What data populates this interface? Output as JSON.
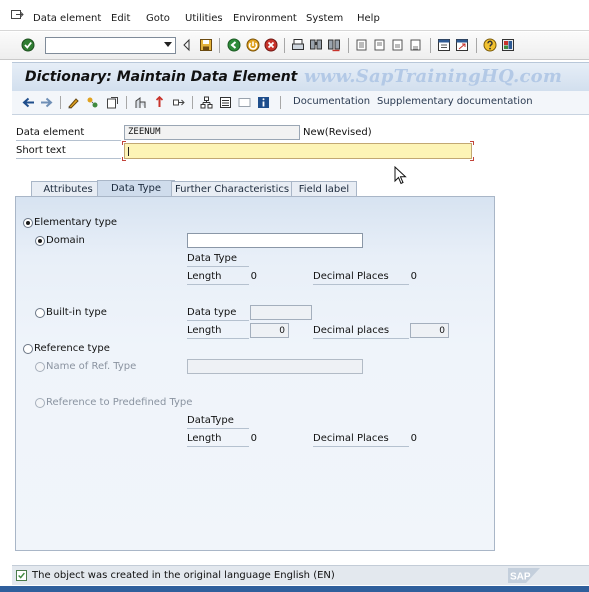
{
  "menu": {
    "items": [
      "Data element",
      "Edit",
      "Goto",
      "Utilities",
      "Environment",
      "System",
      "Help"
    ]
  },
  "toolbar": {
    "command_field_value": ""
  },
  "title": "Dictionary: Maintain Data Element",
  "watermark": "www.SapTrainingHQ.com",
  "app_toolbar": {
    "documentation_label": "Documentation",
    "supplementary_label": "Supplementary documentation"
  },
  "form": {
    "data_element_label": "Data element",
    "data_element_value": "ZEENUM",
    "status_text": "New(Revised)",
    "short_text_label": "Short text",
    "short_text_value": ""
  },
  "tabs": [
    {
      "label": "Attributes",
      "active": false
    },
    {
      "label": "Data Type",
      "active": true
    },
    {
      "label": "Further Characteristics",
      "active": false
    },
    {
      "label": "Field label",
      "active": false
    }
  ],
  "datatype_tab": {
    "elementary_type_label": "Elementary type",
    "domain_label": "Domain",
    "domain_value": "",
    "domain_data_type_label": "Data Type",
    "domain_length_label": "Length",
    "domain_length_value": "0",
    "domain_decimal_label": "Decimal Places",
    "domain_decimal_value": "0",
    "builtin_type_label": "Built-in type",
    "builtin_data_type_label": "Data type",
    "builtin_data_type_value": "",
    "builtin_length_label": "Length",
    "builtin_length_value": "0",
    "builtin_decimal_label": "Decimal places",
    "builtin_decimal_value": "0",
    "reference_type_label": "Reference type",
    "ref_name_label": "Name of Ref. Type",
    "ref_name_value": "",
    "ref_predefined_label": "Reference to Predefined Type",
    "ref_data_type_label": "DataType",
    "ref_length_label": "Length",
    "ref_length_value": "0",
    "ref_decimal_label": "Decimal Places",
    "ref_decimal_value": "0",
    "selected_main": "Elementary type",
    "selected_sub": "Domain"
  },
  "status_bar": {
    "message": "The object was created in the original language English (EN)",
    "logo_text": "SAP"
  },
  "colors": {
    "title_bg": "#d2dfee",
    "panel_bg": "#e8eff8",
    "required_field_bg": "#fdf4b6",
    "watermark": "#b3c9e6",
    "status_ok": "#3f8a3f"
  }
}
